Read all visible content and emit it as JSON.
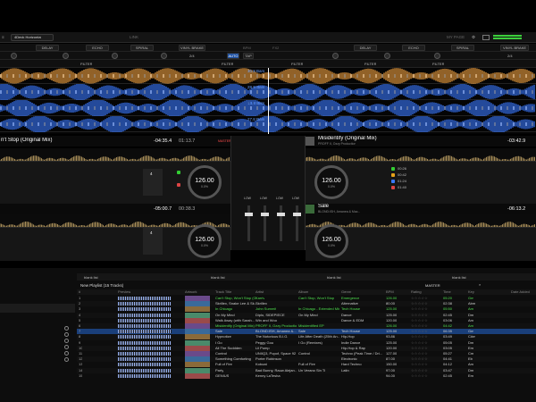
{
  "topbar": {
    "layout": "4Deck Horizontal",
    "link": "LINK",
    "my_page": "MY PAGE"
  },
  "fx": {
    "left": [
      "DELAY",
      "ECHO",
      "SPIRAL",
      "VINYL BRAKE"
    ],
    "right": [
      "DELAY",
      "ECHO",
      "SPIRAL",
      "VINYL BRAKE"
    ],
    "center_left": "BPM",
    "center_right": "FX2",
    "auto": "AUTO",
    "tap": "TAP",
    "beat_left": "2/4",
    "beat_right": "2/4",
    "filters": [
      "FILTER",
      "FILTER",
      "FILTER",
      "FILTER",
      "FILTER"
    ]
  },
  "waves": {
    "times": [
      "30.8 Bars",
      "28.8 Bars",
      "13.8 Bars",
      "27.8 Bars"
    ],
    "colors": [
      "#f0a040",
      "#3a78ff",
      "#3a78ff",
      "#3a78ff"
    ]
  },
  "decks": [
    {
      "title": "n't Stop (Original Mix)",
      "remaining": "-04:35.4",
      "elapsed": "01:13.7",
      "bpm": "126.00",
      "pitch": "0.0%",
      "key": "Gm",
      "beat": "4",
      "master": "MASTER"
    },
    {
      "title": "Misidentify (Original Mix)",
      "artist": "PROFF II, Ozzy Production",
      "remaining": "-03:42.9",
      "elapsed": "00:59.9",
      "bpm": "126.00",
      "pitch": "0.0%",
      "beat": "4",
      "cues": [
        "00:26",
        "00:42",
        "01:24",
        "01:40"
      ]
    },
    {
      "remaining": "-05:00.7",
      "elapsed": "00:38.3",
      "bpm": "126.00",
      "pitch": "0.0%",
      "key": "Gm",
      "beat": "4"
    },
    {
      "title": "Sale",
      "artist": "BLOND:ISH, Amanea & Mac...",
      "remaining": "-06:13.2",
      "elapsed": "00:33.3",
      "bpm": "126.00",
      "pitch": "0.0%",
      "beat": "4"
    }
  ],
  "mixer": {
    "labels": [
      "LOW",
      "LOW",
      "LOW",
      "LOW"
    ]
  },
  "browser": {
    "panels": [
      "blank list",
      "blank list",
      "blank list",
      "blank list"
    ],
    "master_btn": "MASTER",
    "playlist": "New Playlist (15 Tracks)",
    "columns": [
      "#",
      "Preview",
      "Artwork",
      "Track Title",
      "Artist",
      "Album",
      "Genre",
      "BPM",
      "Rating",
      "Time",
      "Key",
      "Date Added"
    ],
    "rows": [
      {
        "n": "1",
        "title": "Can't Stop, Won't Stop (Original Mix)",
        "artist": "Karriv",
        "album": "Can't Stop, Won't Stop",
        "genre": "Emergence",
        "bpm": "126.00",
        "time": "05:20",
        "key": "Gm",
        "hl": "green"
      },
      {
        "n": "2",
        "title": "Skrillex, Snake Lee & Sk...",
        "artist": "Skrillex",
        "album": "",
        "genre": "Alternative",
        "bpm": "80.00",
        "time": "02:38",
        "key": "Abm",
        "hl": ""
      },
      {
        "n": "3",
        "title": "In Chicago",
        "artist": "John Summit",
        "album": "In Chicago - Extended Mix",
        "genre": "Tech House",
        "bpm": "125.00",
        "time": "05:50",
        "key": "Am",
        "hl": "green"
      },
      {
        "n": "4",
        "title": "On My Mind",
        "artist": "Diplo, SIDEPIECE",
        "album": "On My Mind",
        "genre": "Dance",
        "bpm": "125.00",
        "time": "02:45",
        "key": "Dm",
        "hl": ""
      },
      {
        "n": "5",
        "title": "Walk Away (with Sarah...",
        "artist": "Win and Woo",
        "album": "",
        "genre": "Dance & EDM",
        "bpm": "120.00",
        "time": "03:06",
        "key": "Am",
        "hl": ""
      },
      {
        "n": "6",
        "title": "Misidentify (Original Mix)",
        "artist": "PROFF II, Ozzy Production",
        "album": "Misidentified EP",
        "genre": "",
        "bpm": "126.00",
        "time": "04:42",
        "key": "Am",
        "hl": "green"
      },
      {
        "n": "7",
        "title": "Sale",
        "artist": "BLOND:ISH, Amanea &...",
        "album": "Sale",
        "genre": "Tech House",
        "bpm": "125.00",
        "time": "06:35",
        "key": "Gm",
        "hl": "blue"
      },
      {
        "n": "8",
        "title": "Hypnotize",
        "artist": "The Notorious B.I.G.",
        "album": "Life After Death (25th An...",
        "genre": "Hip-Hop",
        "bpm": "93.86",
        "time": "03:49",
        "key": "C#m",
        "hl": ""
      },
      {
        "n": "9",
        "title": "I Go",
        "artist": "Peggy Gou",
        "album": "I Go (Remixes)",
        "genre": "Indie Dance",
        "bpm": "125.00",
        "time": "05:05",
        "key": "Dm",
        "hl": ""
      },
      {
        "n": "10",
        "title": "All The Suddden",
        "artist": "Lil Pump",
        "album": "",
        "genre": "Hip-Hop & Rap",
        "bpm": "120.00",
        "time": "03:05",
        "key": "Em",
        "hl": ""
      },
      {
        "n": "11",
        "title": "Control",
        "artist": "UNIIQ3, Popof, Space 92",
        "album": "Control",
        "genre": "Techno (Peak Time / Dri...",
        "bpm": "127.00",
        "time": "05:27",
        "key": "Cm",
        "hl": ""
      },
      {
        "n": "12",
        "title": "Something Comforting",
        "artist": "Porter Robinson",
        "album": "",
        "genre": "Electronic",
        "bpm": "87.00",
        "time": "04:41",
        "key": "Eb",
        "hl": ""
      },
      {
        "n": "13",
        "title": "Full of Fire",
        "artist": "Koboat",
        "album": "Full of Fire",
        "genre": "Hard Techno",
        "bpm": "150.00",
        "time": "04:12",
        "key": "Am",
        "hl": ""
      },
      {
        "n": "14",
        "title": "Party",
        "artist": "Bad Bunny, Rauw Alejan...",
        "album": "Un Verano Sin Ti",
        "genre": "Latin",
        "bpm": "97.00",
        "time": "03:47",
        "key": "Dm",
        "hl": ""
      },
      {
        "n": "15",
        "title": "GENIUS",
        "artist": "Kenny LaTesha",
        "album": "",
        "genre": "",
        "bpm": "94.00",
        "time": "02:45",
        "key": "Em",
        "hl": ""
      }
    ],
    "sidebar_icons": [
      "gear-icon",
      "gear-icon",
      "gear-icon",
      "gear-icon",
      "gear-icon",
      "gear-icon"
    ]
  }
}
